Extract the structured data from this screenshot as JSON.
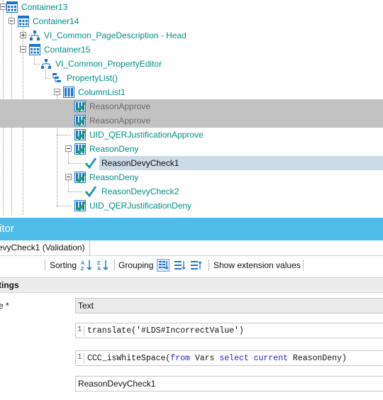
{
  "tree": {
    "nodes": [
      {
        "label": "Container13"
      },
      {
        "label": "Container14"
      },
      {
        "label": "VI_Common_PageDescription - Head"
      },
      {
        "label": "Container15"
      },
      {
        "label": "VI_Common_PropertyEditor"
      },
      {
        "label": "PropertyList()"
      },
      {
        "label": "ColumnList1"
      },
      {
        "label": "ReasonApprove"
      },
      {
        "label": "ReasonApprove"
      },
      {
        "label": "UID_QERJustificationApprove"
      },
      {
        "label": "ReasonDeny"
      },
      {
        "label": "ReasonDevyCheck1"
      },
      {
        "label": "ReasonDeny"
      },
      {
        "label": "ReasonDevyCheck2"
      },
      {
        "label": "UID_QERJustificationDeny"
      }
    ]
  },
  "editor": {
    "title": "itor",
    "tab": "evyCheck1 (Validation)",
    "toolbar": {
      "sorting": "Sorting",
      "grouping": "Grouping",
      "show_extension": "Show extension values"
    },
    "section": "tings",
    "props": [
      {
        "label": "e *",
        "value": "Text"
      },
      {
        "label": "",
        "line": "1",
        "value": "translate('#LDS#IncorrectValue')"
      },
      {
        "label": "",
        "line": "1",
        "code_prefix": "CCC_isWhiteSpace(",
        "code_kw1": "from",
        "code_mid1": " Vars ",
        "code_kw2": "select",
        "code_mid2": " ",
        "code_kw3": "current",
        "code_suffix": " ReasonDeny)"
      },
      {
        "label": "",
        "value": "ReasonDevyCheck1"
      }
    ]
  },
  "colors": {
    "accent": "#50bde8",
    "tree_text": "#008f84",
    "selection": "#ccd9e6",
    "disabled_row": "#c2c2c2"
  }
}
